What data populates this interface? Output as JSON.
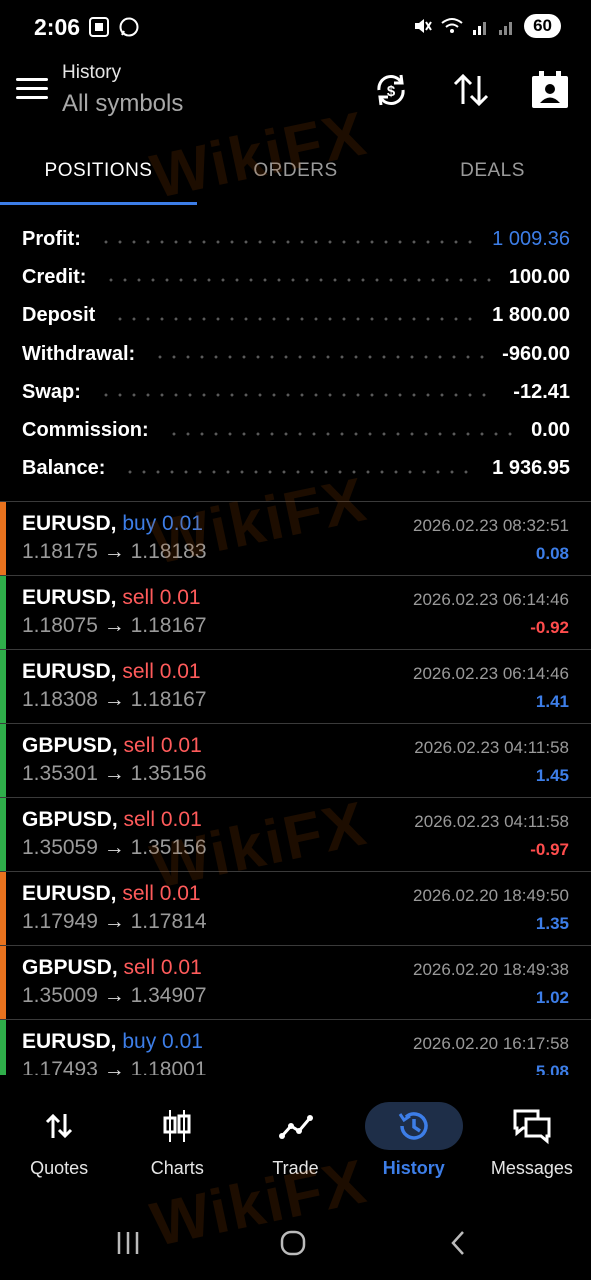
{
  "status_bar": {
    "time": "2:06",
    "battery": "60"
  },
  "header": {
    "title": "History",
    "subtitle": "All symbols"
  },
  "tabs": [
    {
      "label": "POSITIONS",
      "active": true
    },
    {
      "label": "ORDERS",
      "active": false
    },
    {
      "label": "DEALS",
      "active": false
    }
  ],
  "summary": [
    {
      "label": "Profit:",
      "value": "1 009.36",
      "highlight": true
    },
    {
      "label": "Credit:",
      "value": "100.00"
    },
    {
      "label": "Deposit",
      "value": "1 800.00"
    },
    {
      "label": "Withdrawal:",
      "value": "-960.00"
    },
    {
      "label": "Swap:",
      "value": "-12.41"
    },
    {
      "label": "Commission:",
      "value": "0.00"
    },
    {
      "label": "Balance:",
      "value": "1 936.95"
    }
  ],
  "positions": [
    {
      "symbol": "EURUSD,",
      "side": "buy 0.01",
      "side_type": "buy",
      "open": "1.18175",
      "close": "1.18183",
      "time": "2026.02.23 08:32:51",
      "profit": "0.08",
      "bar_color": "#e8721e"
    },
    {
      "symbol": "EURUSD,",
      "side": "sell 0.01",
      "side_type": "sell",
      "open": "1.18075",
      "close": "1.18167",
      "time": "2026.02.23 06:14:46",
      "profit": "-0.92",
      "bar_color": "#2fae4a"
    },
    {
      "symbol": "EURUSD,",
      "side": "sell 0.01",
      "side_type": "sell",
      "open": "1.18308",
      "close": "1.18167",
      "time": "2026.02.23 06:14:46",
      "profit": "1.41",
      "bar_color": "#2fae4a"
    },
    {
      "symbol": "GBPUSD,",
      "side": "sell 0.01",
      "side_type": "sell",
      "open": "1.35301",
      "close": "1.35156",
      "time": "2026.02.23 04:11:58",
      "profit": "1.45",
      "bar_color": "#2fae4a"
    },
    {
      "symbol": "GBPUSD,",
      "side": "sell 0.01",
      "side_type": "sell",
      "open": "1.35059",
      "close": "1.35156",
      "time": "2026.02.23 04:11:58",
      "profit": "-0.97",
      "bar_color": "#2fae4a"
    },
    {
      "symbol": "EURUSD,",
      "side": "sell 0.01",
      "side_type": "sell",
      "open": "1.17949",
      "close": "1.17814",
      "time": "2026.02.20 18:49:50",
      "profit": "1.35",
      "bar_color": "#e8721e"
    },
    {
      "symbol": "GBPUSD,",
      "side": "sell 0.01",
      "side_type": "sell",
      "open": "1.35009",
      "close": "1.34907",
      "time": "2026.02.20 18:49:38",
      "profit": "1.02",
      "bar_color": "#e8721e"
    },
    {
      "symbol": "EURUSD,",
      "side": "buy 0.01",
      "side_type": "buy",
      "open": "1.17493",
      "close": "1.18001",
      "time": "2026.02.20 16:17:58",
      "profit": "5.08",
      "bar_color": "#2fae4a"
    }
  ],
  "bottom_nav": [
    {
      "label": "Quotes",
      "icon": "quotes-icon",
      "active": false
    },
    {
      "label": "Charts",
      "icon": "charts-icon",
      "active": false
    },
    {
      "label": "Trade",
      "icon": "trade-icon",
      "active": false
    },
    {
      "label": "History",
      "icon": "history-icon",
      "active": true
    },
    {
      "label": "Messages",
      "icon": "messages-icon",
      "active": false
    }
  ],
  "watermark": "WikiFX",
  "colors": {
    "accent": "#3d7ee8",
    "sell": "#ff5b5b",
    "loss": "#ff4d4d",
    "buy_bar": "#e8721e",
    "sell_bar": "#2fae4a"
  }
}
